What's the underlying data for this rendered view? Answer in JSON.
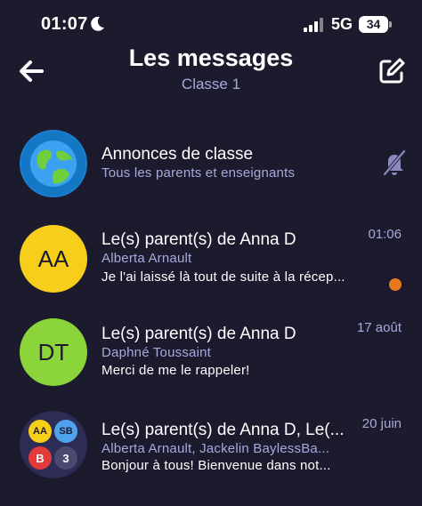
{
  "status_bar": {
    "time": "01:07",
    "network": "5G",
    "battery": "34"
  },
  "header": {
    "title": "Les messages",
    "subtitle": "Classe 1"
  },
  "conversations": [
    {
      "title": "Annonces de classe",
      "subtitle": "Tous les parents et enseignants",
      "muted": true,
      "avatar_icon": "globe-icon"
    },
    {
      "title": "Le(s) parent(s) de Anna D",
      "subtitle": "Alberta Arnault",
      "message": "Je l'ai laissé là tout de suite à la récep...",
      "time": "01:06",
      "unread": true,
      "avatar_initials": "AA",
      "avatar_color": "#f7cf1b"
    },
    {
      "title": "Le(s) parent(s) de Anna D",
      "subtitle": "Daphné Toussaint",
      "message": "Merci de me le rappeler!",
      "time": "17 août",
      "avatar_initials": "DT",
      "avatar_color": "#8bd43a"
    },
    {
      "title": "Le(s) parent(s) de Anna D, Le(...",
      "subtitle": "Alberta Arnault, Jackelin BaylessBa...",
      "message": "Bonjour à tous! Bienvenue dans not...",
      "time": "20 juin",
      "group_avatars": [
        "AA",
        "SB",
        "B",
        "3"
      ]
    }
  ],
  "colors": {
    "background": "#1c1b2e",
    "accent_text": "#a9a8dd",
    "unread_dot": "#e6781e"
  }
}
